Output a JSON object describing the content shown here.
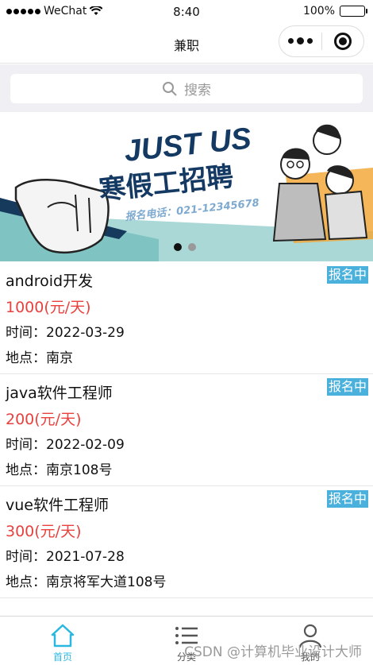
{
  "status_bar": {
    "carrier": "WeChat",
    "time": "8:40",
    "battery": "100%"
  },
  "nav": {
    "title": "兼职"
  },
  "search": {
    "placeholder": "搜索"
  },
  "banner": {
    "headline": "JUST US",
    "title": "寒假工招聘",
    "phone": "报名电话：021-12345678"
  },
  "jobs": [
    {
      "title": "android开发",
      "salary": "1000(元/天)",
      "time": "时间：2022-03-29",
      "location": "地点：南京",
      "status": "报名中"
    },
    {
      "title": "java软件工程师",
      "salary": "200(元/天)",
      "time": "时间：2022-02-09",
      "location": "地点：南京108号",
      "status": "报名中"
    },
    {
      "title": "vue软件工程师",
      "salary": "300(元/天)",
      "time": "时间：2021-07-28",
      "location": "地点：南京将军大道108号",
      "status": "报名中"
    }
  ],
  "tabs": [
    {
      "label": "首页",
      "icon": "home-icon",
      "active": true
    },
    {
      "label": "分类",
      "icon": "list-icon",
      "active": false
    },
    {
      "label": "我的",
      "icon": "user-icon",
      "active": false
    }
  ],
  "watermark": "CSDN @计算机毕业设计大师",
  "colors": {
    "accent": "#2bb8e0",
    "salary": "#e8413e",
    "badge": "#4ab0dc"
  }
}
